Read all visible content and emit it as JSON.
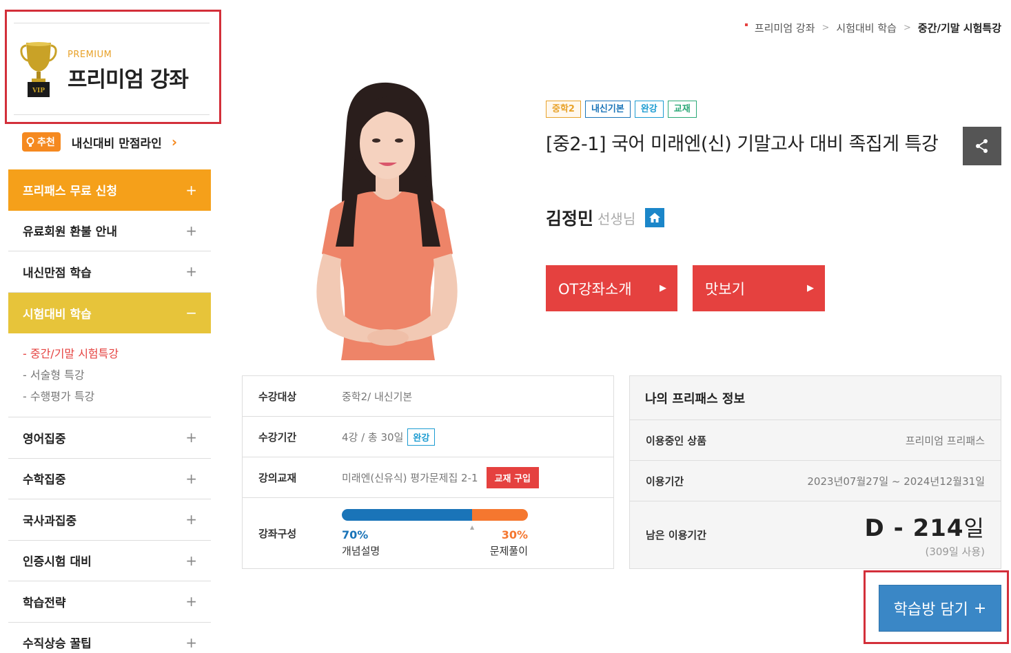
{
  "premium": {
    "sub": "PREMIUM",
    "title": "프리미엄 강좌",
    "trophy_label": "VIP"
  },
  "recommend": {
    "badge": "추천",
    "text": "내신대비 만점라인",
    "arrow": "›"
  },
  "menu": {
    "items": [
      {
        "label": "프리패스 무료 신청",
        "toggle": "+"
      },
      {
        "label": "유료회원 환불 안내",
        "toggle": "+"
      },
      {
        "label": "내신만점 학습",
        "toggle": "+"
      },
      {
        "label": "시험대비 학습",
        "toggle": "−"
      },
      {
        "label": "영어집중",
        "toggle": "+"
      },
      {
        "label": "수학집중",
        "toggle": "+"
      },
      {
        "label": "국사과집중",
        "toggle": "+"
      },
      {
        "label": "인증시험 대비",
        "toggle": "+"
      },
      {
        "label": "학습전략",
        "toggle": "+"
      },
      {
        "label": "수직상승 꿀팁",
        "toggle": "+"
      }
    ],
    "submenu": [
      "- 중간/기말 시험특강",
      "- 서술형 특강",
      "- 수행평가 특강"
    ]
  },
  "breadcrumb": {
    "items": [
      "프리미엄 강좌",
      "시험대비 학습",
      "중간/기말 시험특강"
    ],
    "separator": ">"
  },
  "course": {
    "tags": [
      {
        "label": "중학2",
        "color": "#e8a22a"
      },
      {
        "label": "내신기본",
        "color": "#1a74b8"
      },
      {
        "label": "완강",
        "color": "#1b9bd1"
      },
      {
        "label": "교재",
        "color": "#2aa876"
      }
    ],
    "title": "[중2-1] 국어 미래엔(신) 기말고사 대비 족집게 특강",
    "teacher_name": "김정민",
    "teacher_suffix": "선생님",
    "ot_button": "OT강좌소개",
    "preview_button": "맛보기",
    "button_arrow": "▶"
  },
  "info": {
    "target_label": "수강대상",
    "target_value": "중학2/ 내신기본",
    "period_label": "수강기간",
    "period_value": "4강 / 총 30일",
    "period_badge": "완강",
    "book_label": "강의교재",
    "book_value": "미래엔(신유식) 평가문제집 2-1",
    "book_button": "교재 구입",
    "composition_label": "강좌구성",
    "composition": {
      "concept_percent": 70,
      "concept_percent_text": "70%",
      "concept_label": "개념설명",
      "practice_percent_text": "30%",
      "practice_label": "문제풀이"
    }
  },
  "pass": {
    "heading": "나의 프리패스 정보",
    "product_label": "이용중인 상품",
    "product_value": "프리미엄 프리패스",
    "period_label": "이용기간",
    "period_value": "2023년07월27일 ~ 2024년12월31일",
    "remain_label": "남은 이용기간",
    "dday_prefix": "D - ",
    "dday_number": "214",
    "dday_unit": "일",
    "used_text": "(309일 사용)"
  },
  "add_button": {
    "label": "학습방 담기",
    "icon": "+"
  },
  "colors": {
    "accent_red": "#e5413f",
    "orange": "#f5a01a",
    "yellow": "#e7c43a",
    "blue": "#3a87c6",
    "highlight_border": "#d32f3a"
  }
}
